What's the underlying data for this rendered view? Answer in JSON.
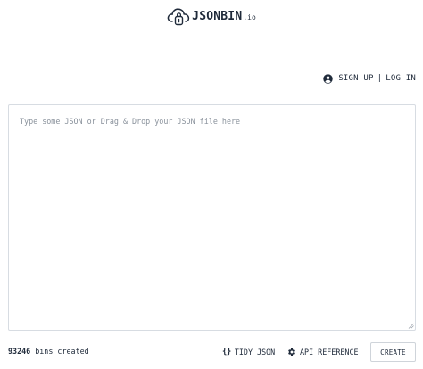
{
  "brand": {
    "name": "JSONBIN",
    "tld": ".io",
    "logo_icon": "cloud-lock-icon"
  },
  "auth": {
    "icon": "user-circle-icon",
    "sign_up": "SIGN UP",
    "separator": "|",
    "log_in": "LOG IN"
  },
  "editor": {
    "placeholder": "Type some JSON or Drag & Drop your JSON file here",
    "value": ""
  },
  "footer": {
    "bins_count": "93246",
    "bins_label": "bins created",
    "tidy_icon": "braces-icon",
    "tidy_glyph": "{}",
    "tidy_label": "TIDY JSON",
    "api_icon": "gear-icon",
    "api_label": "API REFERENCE",
    "create_label": "CREATE"
  },
  "colors": {
    "text": "#1f2a3a",
    "placeholder": "#8a929c",
    "border": "#d7dce2",
    "background": "#ffffff"
  }
}
